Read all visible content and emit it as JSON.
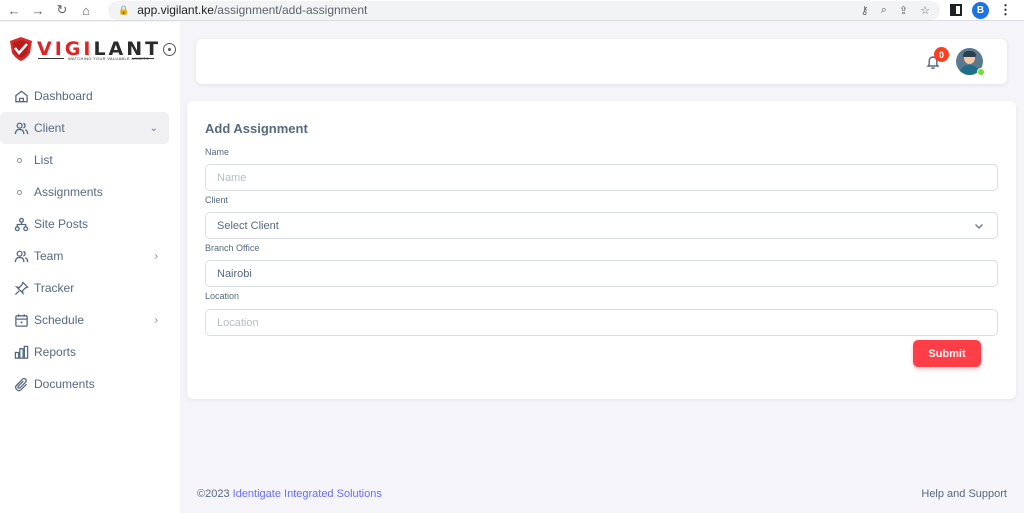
{
  "browser": {
    "url_host": "app.vigilant.ke",
    "url_path": "/assignment/add-assignment",
    "profile_initial": "B"
  },
  "brand": {
    "name_part_red": "VIGI",
    "name_part_dark": "LANT",
    "tagline": "WATCHING YOUR VALUABLE ASSETS"
  },
  "sidebar": {
    "items": [
      {
        "label": "Dashboard",
        "icon": "home-icon"
      },
      {
        "label": "Client",
        "icon": "users-icon",
        "caret": "⌄"
      },
      {
        "label": "List",
        "icon": "bullet"
      },
      {
        "label": "Assignments",
        "icon": "bullet"
      },
      {
        "label": "Site Posts",
        "icon": "sitemap-icon"
      },
      {
        "label": "Team",
        "icon": "users-icon",
        "caret": "›"
      },
      {
        "label": "Tracker",
        "icon": "pin-icon"
      },
      {
        "label": "Schedule",
        "icon": "calendar-icon",
        "caret": "›"
      },
      {
        "label": "Reports",
        "icon": "chart-icon"
      },
      {
        "label": "Documents",
        "icon": "paperclip-icon"
      }
    ]
  },
  "navbar": {
    "notification_count": "0"
  },
  "form": {
    "title": "Add Assignment",
    "name_label": "Name",
    "name_placeholder": "Name",
    "client_label": "Client",
    "client_value": "Select Client",
    "branch_label": "Branch Office",
    "branch_value": "Nairobi",
    "location_label": "Location",
    "location_placeholder": "Location",
    "submit_label": "Submit"
  },
  "footer": {
    "copyright": "©2023 ",
    "company": "Identigate Integrated Solutions",
    "help": "Help and Support"
  },
  "colors": {
    "accent": "#696cff",
    "danger": "#ff3e48",
    "text": "#566a7f"
  }
}
